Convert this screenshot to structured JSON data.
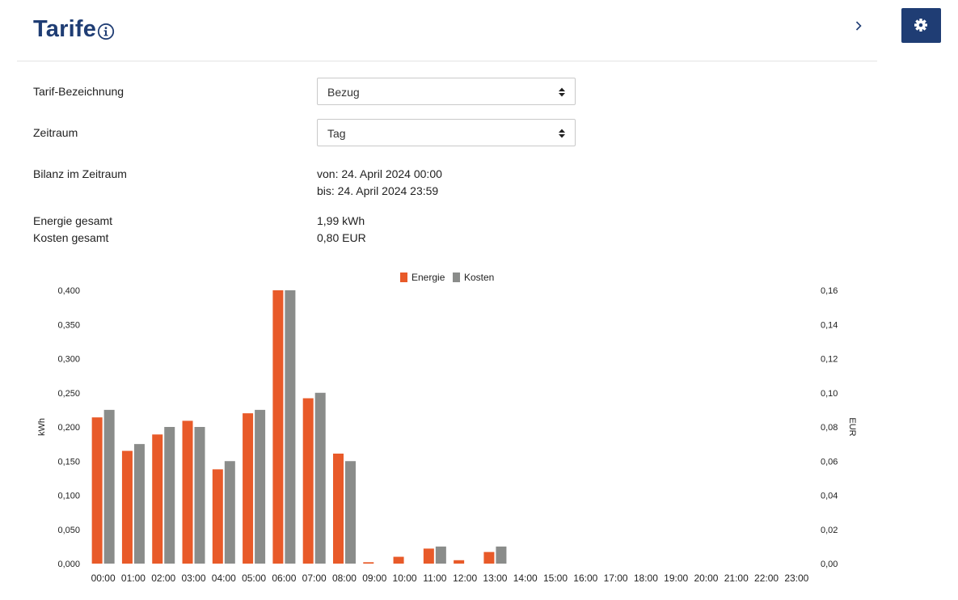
{
  "page": {
    "title": "Tarife"
  },
  "form": {
    "tariff_label": "Tarif-Bezeichnung",
    "tariff_value": "Bezug",
    "period_label": "Zeitraum",
    "period_value": "Tag",
    "balance_label": "Bilanz im Zeitraum",
    "balance_from": "von: 24. April 2024 00:00",
    "balance_to": "bis: 24. April 2024 23:59",
    "energy_label": "Energie gesamt",
    "energy_value": "1,99 kWh",
    "cost_label": "Kosten gesamt",
    "cost_value": "0,80 EUR"
  },
  "colors": {
    "brand": "#1f3d74",
    "energie": "#e85a29",
    "kosten": "#8a8c8a"
  },
  "icons": {
    "info": "info-circle-icon",
    "next": "chevron-right-icon",
    "settings": "gear-icon",
    "select": "sort-arrows-icon"
  },
  "chart_data": {
    "type": "bar",
    "categories": [
      "00:00",
      "01:00",
      "02:00",
      "03:00",
      "04:00",
      "05:00",
      "06:00",
      "07:00",
      "08:00",
      "09:00",
      "10:00",
      "11:00",
      "12:00",
      "13:00",
      "14:00",
      "15:00",
      "16:00",
      "17:00",
      "18:00",
      "19:00",
      "20:00",
      "21:00",
      "22:00",
      "23:00"
    ],
    "series": [
      {
        "name": "Energie",
        "axis": "left",
        "values": [
          0.214,
          0.165,
          0.189,
          0.209,
          0.138,
          0.22,
          0.4,
          0.242,
          0.161,
          0.002,
          0.01,
          0.022,
          0.005,
          0.017,
          0,
          0,
          0,
          0,
          0,
          0,
          0,
          0,
          0,
          0
        ]
      },
      {
        "name": "Kosten",
        "axis": "right",
        "values": [
          0.09,
          0.07,
          0.08,
          0.08,
          0.06,
          0.09,
          0.16,
          0.1,
          0.06,
          0,
          0,
          0.01,
          0,
          0.01,
          0,
          0,
          0,
          0,
          0,
          0,
          0,
          0,
          0,
          0
        ]
      }
    ],
    "ylabel": "kWh",
    "y2label": "EUR",
    "ylim": [
      0,
      0.4
    ],
    "y2lim": [
      0,
      0.16
    ],
    "yticks": [
      "0,000",
      "0,050",
      "0,100",
      "0,150",
      "0,200",
      "0,250",
      "0,300",
      "0,350",
      "0,400"
    ],
    "y2ticks": [
      "0,00",
      "0,02",
      "0,04",
      "0,06",
      "0,08",
      "0,10",
      "0,12",
      "0,14",
      "0,16"
    ],
    "legend_position": "top-center",
    "grid": false
  }
}
